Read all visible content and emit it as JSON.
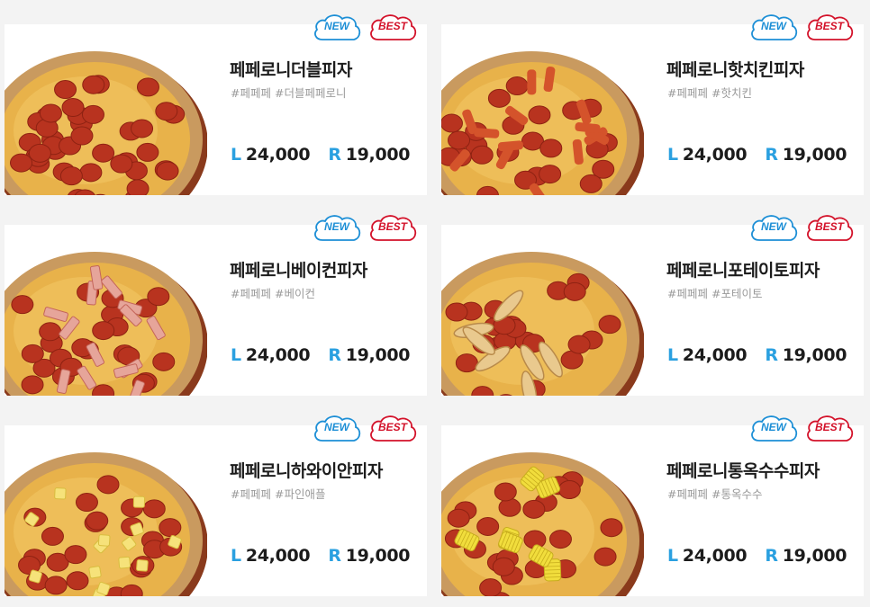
{
  "badges": {
    "new_label": "NEW",
    "best_label": "BEST"
  },
  "size_labels": {
    "large": "L",
    "regular": "R"
  },
  "colors": {
    "new": "#1d8fd6",
    "best": "#d3122a",
    "size": "#2aa0e0"
  },
  "pizzas": [
    {
      "name": "페페로니더블피자",
      "tags": [
        "#페페페",
        "#더블페페로니"
      ],
      "price_l": "24,000",
      "price_r": "19,000",
      "topping": "double-pepperoni"
    },
    {
      "name": "페페로니핫치킨피자",
      "tags": [
        "#페페페",
        "#핫치킨"
      ],
      "price_l": "24,000",
      "price_r": "19,000",
      "topping": "hot-chicken"
    },
    {
      "name": "페페로니베이컨피자",
      "tags": [
        "#페페페",
        "#베이컨"
      ],
      "price_l": "24,000",
      "price_r": "19,000",
      "topping": "bacon"
    },
    {
      "name": "페페로니포테이토피자",
      "tags": [
        "#페페페",
        "#포테이토"
      ],
      "price_l": "24,000",
      "price_r": "19,000",
      "topping": "potato"
    },
    {
      "name": "페페로니하와이안피자",
      "tags": [
        "#페페페",
        "#파인애플"
      ],
      "price_l": "24,000",
      "price_r": "19,000",
      "topping": "pineapple"
    },
    {
      "name": "페페로니통옥수수피자",
      "tags": [
        "#페페페",
        "#통옥수수"
      ],
      "price_l": "24,000",
      "price_r": "19,000",
      "topping": "corn"
    }
  ]
}
